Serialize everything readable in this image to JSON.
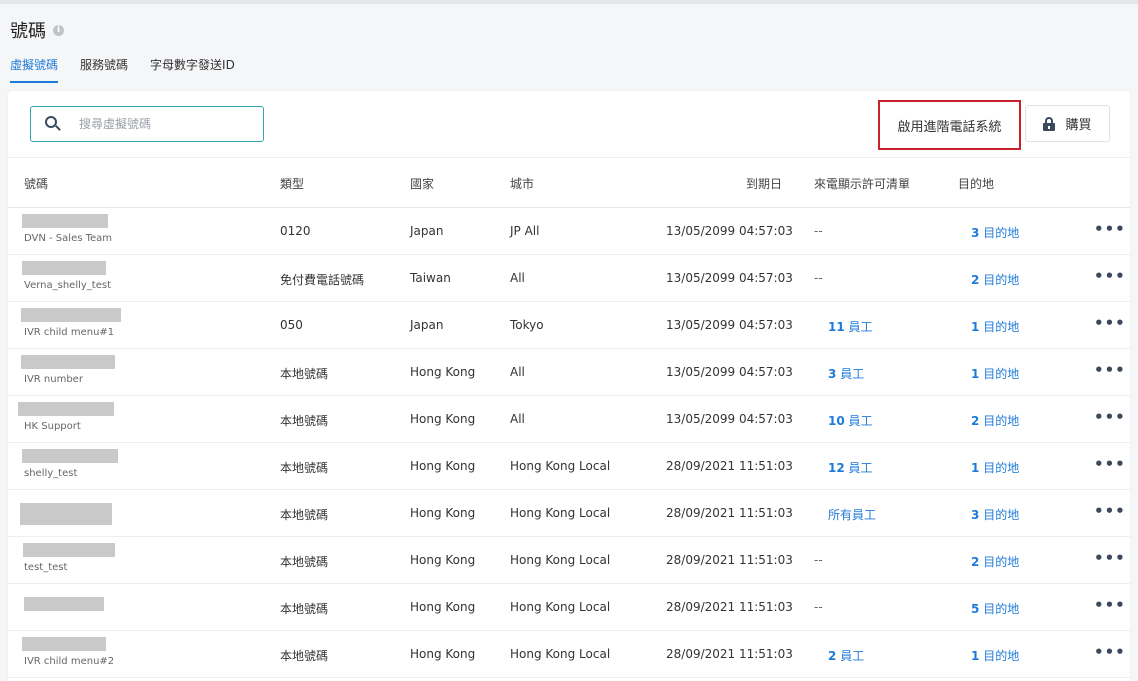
{
  "page": {
    "title": "號碼"
  },
  "tabs": [
    {
      "label": "虛擬號碼",
      "active": true
    },
    {
      "label": "服務號碼",
      "active": false
    },
    {
      "label": "字母數字發送ID",
      "active": false
    }
  ],
  "search": {
    "placeholder": "搜尋虛擬號碼",
    "value": ""
  },
  "toolbar": {
    "advanced_label": "啟用進階電話系統",
    "buy_label": "購買"
  },
  "table": {
    "headers": {
      "number": "號碼",
      "type": "類型",
      "country": "國家",
      "city": "城市",
      "expiry": "到期日",
      "caller_id": "來電顯示許可清單",
      "destination": "目的地"
    },
    "rows": [
      {
        "name": "DVN - Sales Team",
        "type": "0120",
        "country": "Japan",
        "city": "JP All",
        "expiry": "13/05/2099 04:57:03",
        "caller_count": "",
        "caller_text": "--",
        "dest_count": "3",
        "dest_text": "目的地"
      },
      {
        "name": "Verna_shelly_test",
        "type": "免付費電話號碼",
        "country": "Taiwan",
        "city": "All",
        "expiry": "13/05/2099 04:57:03",
        "caller_count": "",
        "caller_text": "--",
        "dest_count": "2",
        "dest_text": "目的地"
      },
      {
        "name": "IVR child menu#1",
        "type": "050",
        "country": "Japan",
        "city": "Tokyo",
        "expiry": "13/05/2099 04:57:03",
        "caller_count": "11",
        "caller_text": "員工",
        "dest_count": "1",
        "dest_text": "目的地"
      },
      {
        "name": "IVR number",
        "type": "本地號碼",
        "country": "Hong Kong",
        "city": "All",
        "expiry": "13/05/2099 04:57:03",
        "caller_count": "3",
        "caller_text": "員工",
        "dest_count": "1",
        "dest_text": "目的地"
      },
      {
        "name": "HK Support",
        "type": "本地號碼",
        "country": "Hong Kong",
        "city": "All",
        "expiry": "13/05/2099 04:57:03",
        "caller_count": "10",
        "caller_text": "員工",
        "dest_count": "2",
        "dest_text": "目的地"
      },
      {
        "name": "shelly_test",
        "type": "本地號碼",
        "country": "Hong Kong",
        "city": "Hong Kong Local",
        "expiry": "28/09/2021 11:51:03",
        "caller_count": "12",
        "caller_text": "員工",
        "dest_count": "1",
        "dest_text": "目的地"
      },
      {
        "name": "",
        "type": "本地號碼",
        "country": "Hong Kong",
        "city": "Hong Kong Local",
        "expiry": "28/09/2021 11:51:03",
        "caller_count": "",
        "caller_text": "所有員工",
        "dest_count": "3",
        "dest_text": "目的地"
      },
      {
        "name": "test_test",
        "type": "本地號碼",
        "country": "Hong Kong",
        "city": "Hong Kong Local",
        "expiry": "28/09/2021 11:51:03",
        "caller_count": "",
        "caller_text": "--",
        "dest_count": "2",
        "dest_text": "目的地"
      },
      {
        "name": "",
        "type": "本地號碼",
        "country": "Hong Kong",
        "city": "Hong Kong Local",
        "expiry": "28/09/2021 11:51:03",
        "caller_count": "",
        "caller_text": "--",
        "dest_count": "5",
        "dest_text": "目的地"
      },
      {
        "name": "IVR child menu#2",
        "type": "本地號碼",
        "country": "Hong Kong",
        "city": "Hong Kong Local",
        "expiry": "28/09/2021 11:51:03",
        "caller_count": "2",
        "caller_text": "員工",
        "dest_count": "1",
        "dest_text": "目的地"
      }
    ],
    "more_label": "•••"
  },
  "icons": {
    "info": "info-icon",
    "search": "search-icon",
    "lock": "lock-icon",
    "more": "more-icon"
  },
  "colors": {
    "accent": "#1f7bd8",
    "highlight_border": "#c8232c",
    "search_border": "#2fa7b4"
  }
}
